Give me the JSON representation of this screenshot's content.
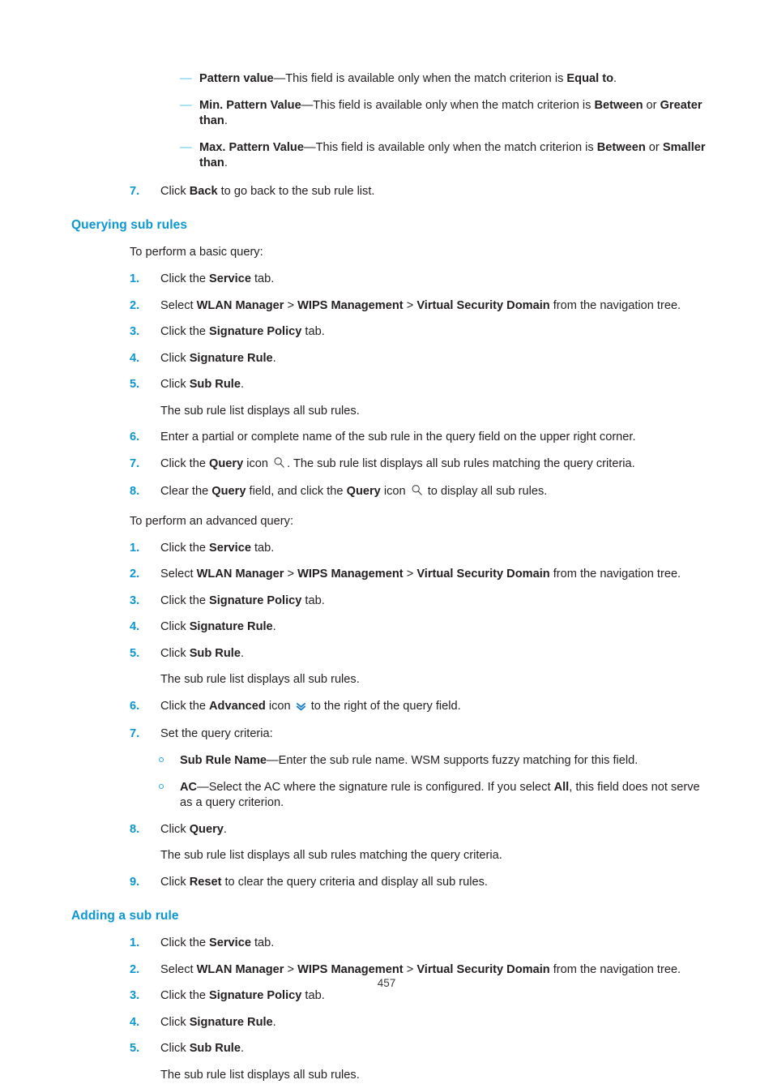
{
  "document": {
    "page_number": "457"
  },
  "colors": {
    "heading_blue": "#0b97d4",
    "number_blue": "#0b97d4",
    "dash_blue": "#57c5e8",
    "circle_blue": "#2ba6de",
    "body_text": "#231f20"
  },
  "top_section": {
    "dash_items": [
      {
        "term": "Pattern value",
        "dash": "—",
        "text_before_bold": "This field is available only when the match criterion is ",
        "bold_tail": "Equal to",
        "text_after": "."
      },
      {
        "term": "Min. Pattern Value",
        "dash": "—",
        "text_before_bold": "This field is available only when the match criterion is ",
        "bold_tail": "Between",
        "mid_text": " or ",
        "bold_tail2": "Greater than",
        "text_after": "."
      },
      {
        "term": "Max. Pattern Value",
        "dash": "—",
        "text_before_bold": "This field is available only when the match criterion is ",
        "bold_tail": "Between",
        "mid_text": " or ",
        "bold_tail2": "Smaller than",
        "text_after": "."
      }
    ],
    "step7": {
      "num": "7.",
      "pre": "Click ",
      "bold": "Back",
      "post": " to go back to the sub rule list."
    }
  },
  "querying_sub_rules": {
    "heading": "Querying sub rules",
    "basic_intro": "To perform a basic query:",
    "basic_steps": [
      {
        "num": "1.",
        "pre": "Click the ",
        "bold": "Service",
        "post": " tab."
      },
      {
        "num": "2.",
        "pre": "Select ",
        "bold": "WLAN Manager",
        "sep1": " > ",
        "bold2": "WIPS Management",
        "sep2": " > ",
        "bold3": "Virtual Security Domain",
        "post": " from the navigation tree."
      },
      {
        "num": "3.",
        "pre": "Click the ",
        "bold": "Signature Policy",
        "post": " tab."
      },
      {
        "num": "4.",
        "pre": "Click ",
        "bold": "Signature Rule",
        "post": "."
      },
      {
        "num": "5.",
        "pre": "Click ",
        "bold": "Sub Rule",
        "post": "."
      }
    ],
    "basic_note": "The sub rule list displays all sub rules.",
    "basic_steps_cont": [
      {
        "num": "6.",
        "pre": "Enter a partial or complete name of the sub rule in the query field on the upper right corner.",
        "bold": "",
        "post": ""
      },
      {
        "num": "7.",
        "pre": "Click the ",
        "bold": "Query",
        "mid": " icon ",
        "icon": "search-icon",
        "post": ". The sub rule list displays all sub rules matching the query criteria."
      },
      {
        "num": "8.",
        "pre": "Clear the ",
        "bold": "Query",
        "mid": " field, and click the ",
        "bold2": "Query",
        "mid2": " icon ",
        "icon": "search-icon",
        "post": " to display all sub rules."
      }
    ],
    "advanced_intro": "To perform an advanced query:",
    "advanced_steps": [
      {
        "num": "1.",
        "pre": "Click the ",
        "bold": "Service",
        "post": " tab."
      },
      {
        "num": "2.",
        "pre": "Select ",
        "bold": "WLAN Manager",
        "sep1": " > ",
        "bold2": "WIPS Management",
        "sep2": " > ",
        "bold3": "Virtual Security Domain",
        "post": " from the navigation tree."
      },
      {
        "num": "3.",
        "pre": "Click the ",
        "bold": "Signature Policy",
        "post": " tab."
      },
      {
        "num": "4.",
        "pre": "Click ",
        "bold": "Signature Rule",
        "post": "."
      },
      {
        "num": "5.",
        "pre": "Click ",
        "bold": "Sub Rule",
        "post": "."
      }
    ],
    "advanced_note": "The sub rule list displays all sub rules.",
    "advanced_step6": {
      "num": "6.",
      "pre": "Click the ",
      "bold": "Advanced",
      "mid": " icon ",
      "icon": "advanced-chevron-icon",
      "post": " to the right of the query field."
    },
    "advanced_step7": {
      "num": "7.",
      "text": "Set the query criteria:"
    },
    "criteria": [
      {
        "term": "Sub Rule Name",
        "dash": "—",
        "text": "Enter the sub rule name. WSM supports fuzzy matching for this field."
      },
      {
        "term": "AC",
        "dash": "—",
        "text_before_bold": "Select the AC where the signature rule is configured. If you select ",
        "bold_tail": "All",
        "text_after": ", this field does not serve as a query criterion."
      }
    ],
    "advanced_step8": {
      "num": "8.",
      "pre": "Click ",
      "bold": "Query",
      "post": "."
    },
    "advanced_step8_note": "The sub rule list displays all sub rules matching the query criteria.",
    "advanced_step9": {
      "num": "9.",
      "pre": "Click ",
      "bold": "Reset",
      "post": " to clear the query criteria and display all sub rules."
    }
  },
  "adding_a_sub_rule": {
    "heading": "Adding a sub rule",
    "steps": [
      {
        "num": "1.",
        "pre": "Click the ",
        "bold": "Service",
        "post": " tab."
      },
      {
        "num": "2.",
        "pre": "Select ",
        "bold": "WLAN Manager",
        "sep1": " > ",
        "bold2": "WIPS Management",
        "sep2": " > ",
        "bold3": "Virtual Security Domain",
        "post": " from the navigation tree."
      },
      {
        "num": "3.",
        "pre": "Click the ",
        "bold": "Signature Policy",
        "post": " tab."
      },
      {
        "num": "4.",
        "pre": "Click ",
        "bold": "Signature Rule",
        "post": "."
      },
      {
        "num": "5.",
        "pre": "Click ",
        "bold": "Sub Rule",
        "post": "."
      }
    ],
    "note": "The sub rule list displays all sub rules."
  }
}
